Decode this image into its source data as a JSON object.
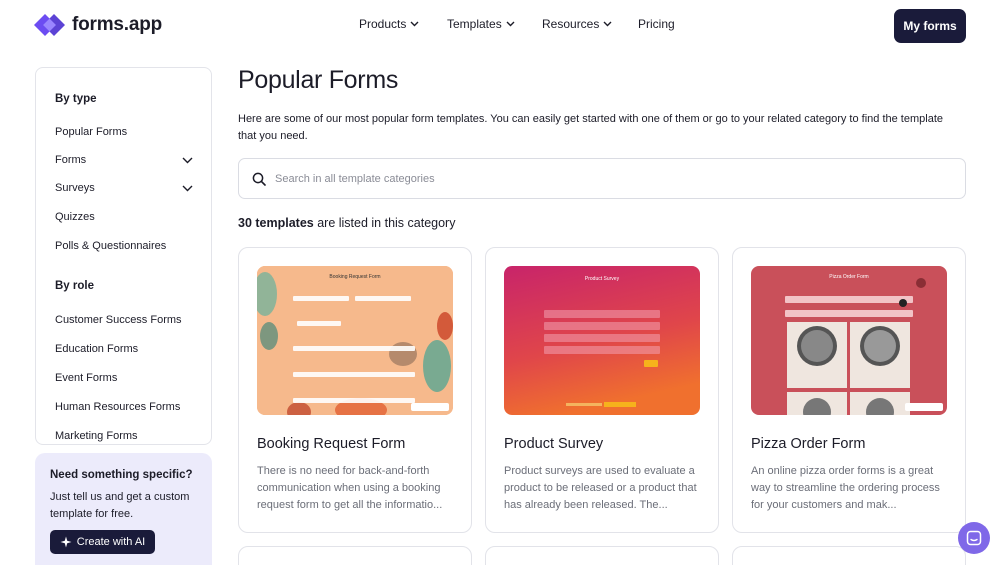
{
  "header": {
    "logo_text": "forms.app",
    "nav": [
      {
        "label": "Products",
        "has_dropdown": true
      },
      {
        "label": "Templates",
        "has_dropdown": true
      },
      {
        "label": "Resources",
        "has_dropdown": true
      },
      {
        "label": "Pricing",
        "has_dropdown": false
      }
    ],
    "my_forms_label": "My forms"
  },
  "sidebar": {
    "by_type_heading": "By type",
    "type_items": [
      {
        "label": "Popular Forms",
        "has_dropdown": false
      },
      {
        "label": "Forms",
        "has_dropdown": true
      },
      {
        "label": "Surveys",
        "has_dropdown": true
      },
      {
        "label": "Quizzes",
        "has_dropdown": false
      },
      {
        "label": "Polls & Questionnaires",
        "has_dropdown": false
      }
    ],
    "by_role_heading": "By role",
    "role_items": [
      {
        "label": "Customer Success Forms"
      },
      {
        "label": "Education Forms"
      },
      {
        "label": "Event Forms"
      },
      {
        "label": "Human Resources Forms"
      },
      {
        "label": "Marketing Forms"
      }
    ]
  },
  "promo": {
    "title": "Need something specific?",
    "text": "Just tell us and get a custom template for free.",
    "button_label": "Create with AI"
  },
  "main": {
    "title": "Popular Forms",
    "intro": "Here are some of our most popular form templates. You can easily get started with one of them or go to your related category to find the template that you need.",
    "search_placeholder": "Search in all template categories",
    "count_number": "30 templates",
    "count_suffix": " are listed in this category"
  },
  "cards": [
    {
      "title": "Booking Request Form",
      "description": "There is no need for back-and-forth communication when using a booking request form to get all the informatio...",
      "thumb_header": "Booking Request Form",
      "thumb_bg": "#f6b98c"
    },
    {
      "title": "Product Survey",
      "description": "Product surveys are used to evaluate a product to be released or a product that has already been released. The...",
      "thumb_header": "Product Survey",
      "thumb_bg": "#d8345a"
    },
    {
      "title": "Pizza Order Form",
      "description": "An online pizza order forms is a great way to streamline the ordering process for your customers and mak...",
      "thumb_header": "Pizza Order Form",
      "thumb_bg": "#c9505a"
    }
  ],
  "colors": {
    "brand_dark": "#1a1b3a",
    "logo_purple": "#6c4cf2",
    "chat_purple": "#7f68e8",
    "promo_bg": "#ecebfb"
  }
}
